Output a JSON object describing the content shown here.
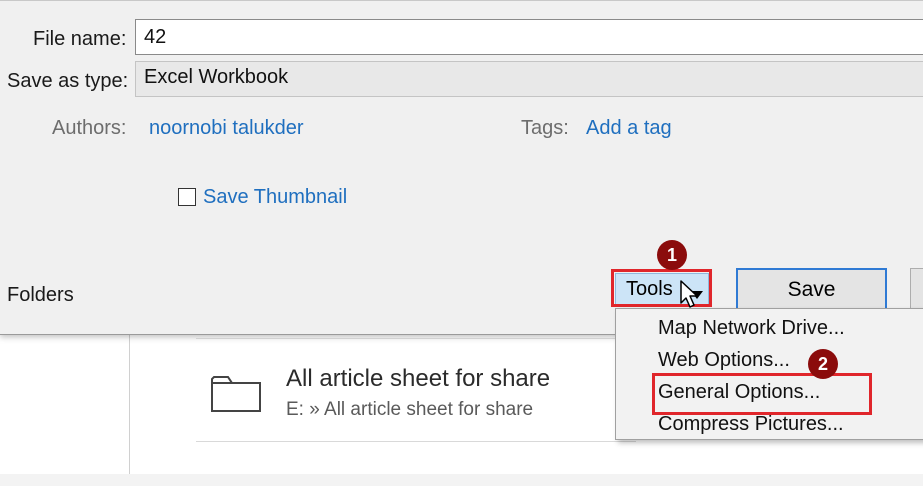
{
  "dialog": {
    "file_name_label": "File name:",
    "file_name_value": "42",
    "save_as_type_label": "Save as type:",
    "save_as_type_value": "Excel Workbook",
    "authors_label": "Authors:",
    "authors_value": "noornobi talukder",
    "tags_label": "Tags:",
    "tags_value": "Add a tag",
    "save_thumbnail_label": "Save Thumbnail",
    "save_thumbnail_checked": false,
    "folders_label": "Folders",
    "tools_label": "Tools",
    "save_label": "Save"
  },
  "tools_menu": {
    "items": [
      {
        "label": "Map Network Drive..."
      },
      {
        "label": "Web Options..."
      },
      {
        "label": "General Options..."
      },
      {
        "label": "Compress Pictures..."
      }
    ]
  },
  "annotations": {
    "badge_1": "1",
    "badge_2": "2",
    "highlight_color": "#e0262b",
    "badge_color": "#8b0c0c"
  },
  "background": {
    "folder_title": "All article sheet for share",
    "folder_path": "E: » All article sheet for share"
  },
  "colors": {
    "link": "#1f6fbf",
    "tools_button_bg": "#cce4f7",
    "save_button_border": "#2f7ad4"
  }
}
